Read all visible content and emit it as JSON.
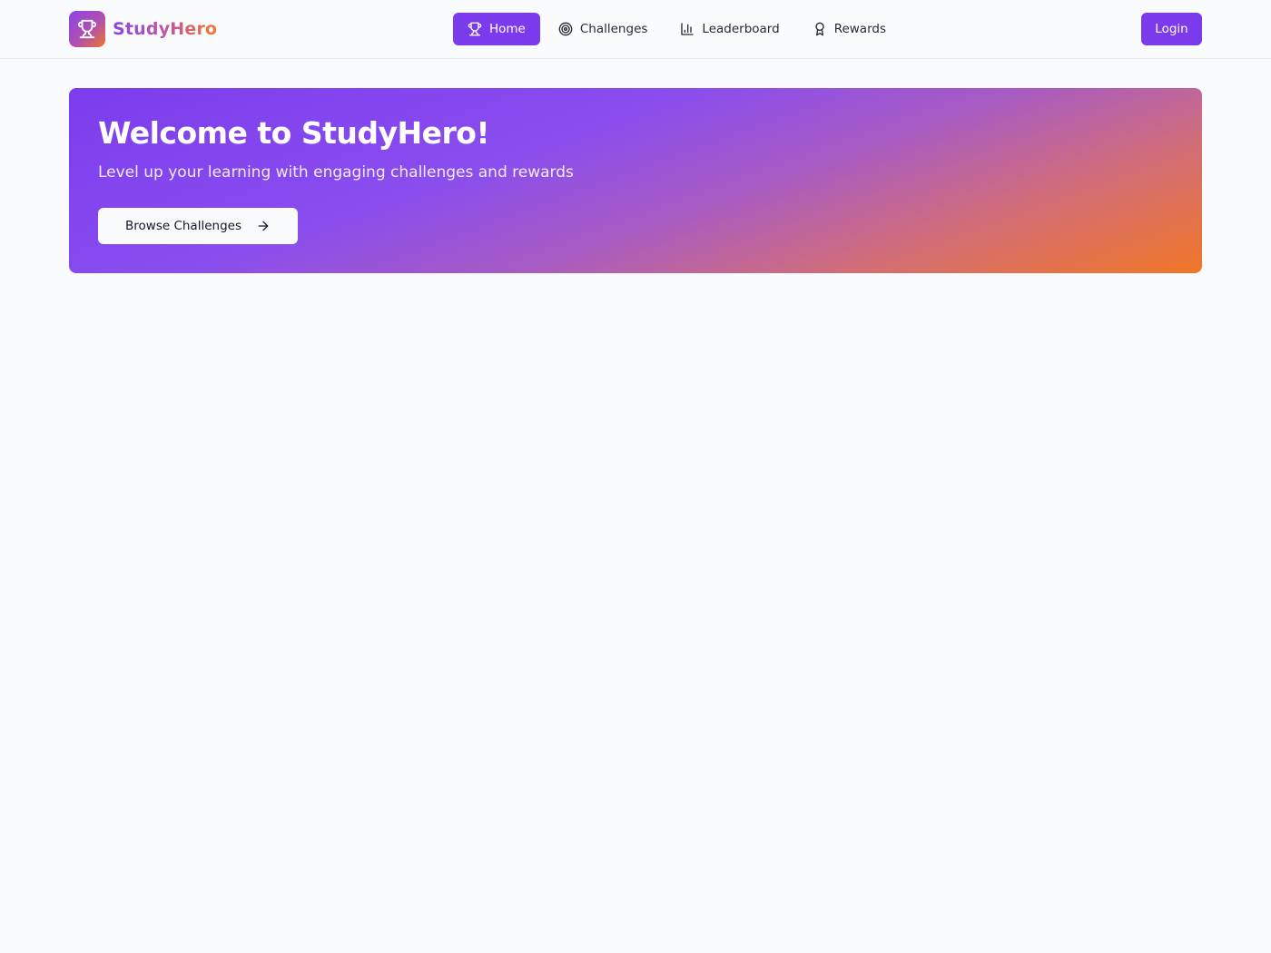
{
  "brand": {
    "name": "StudyHero",
    "logo_icon": "trophy-icon"
  },
  "nav": {
    "items": [
      {
        "label": "Home",
        "icon": "trophy-icon",
        "active": true
      },
      {
        "label": "Challenges",
        "icon": "target-icon",
        "active": false
      },
      {
        "label": "Leaderboard",
        "icon": "bar-chart-icon",
        "active": false
      },
      {
        "label": "Rewards",
        "icon": "award-icon",
        "active": false
      }
    ]
  },
  "header": {
    "login_label": "Login"
  },
  "hero": {
    "title": "Welcome to StudyHero!",
    "subtitle": "Level up your learning with engaging challenges and rewards",
    "cta_label": "Browse Challenges",
    "cta_icon": "arrow-right-icon"
  },
  "colors": {
    "accent": "#7c3aed",
    "gradient_start": "#7b3ded",
    "gradient_end": "#f07626",
    "background": "#f9fafc"
  }
}
